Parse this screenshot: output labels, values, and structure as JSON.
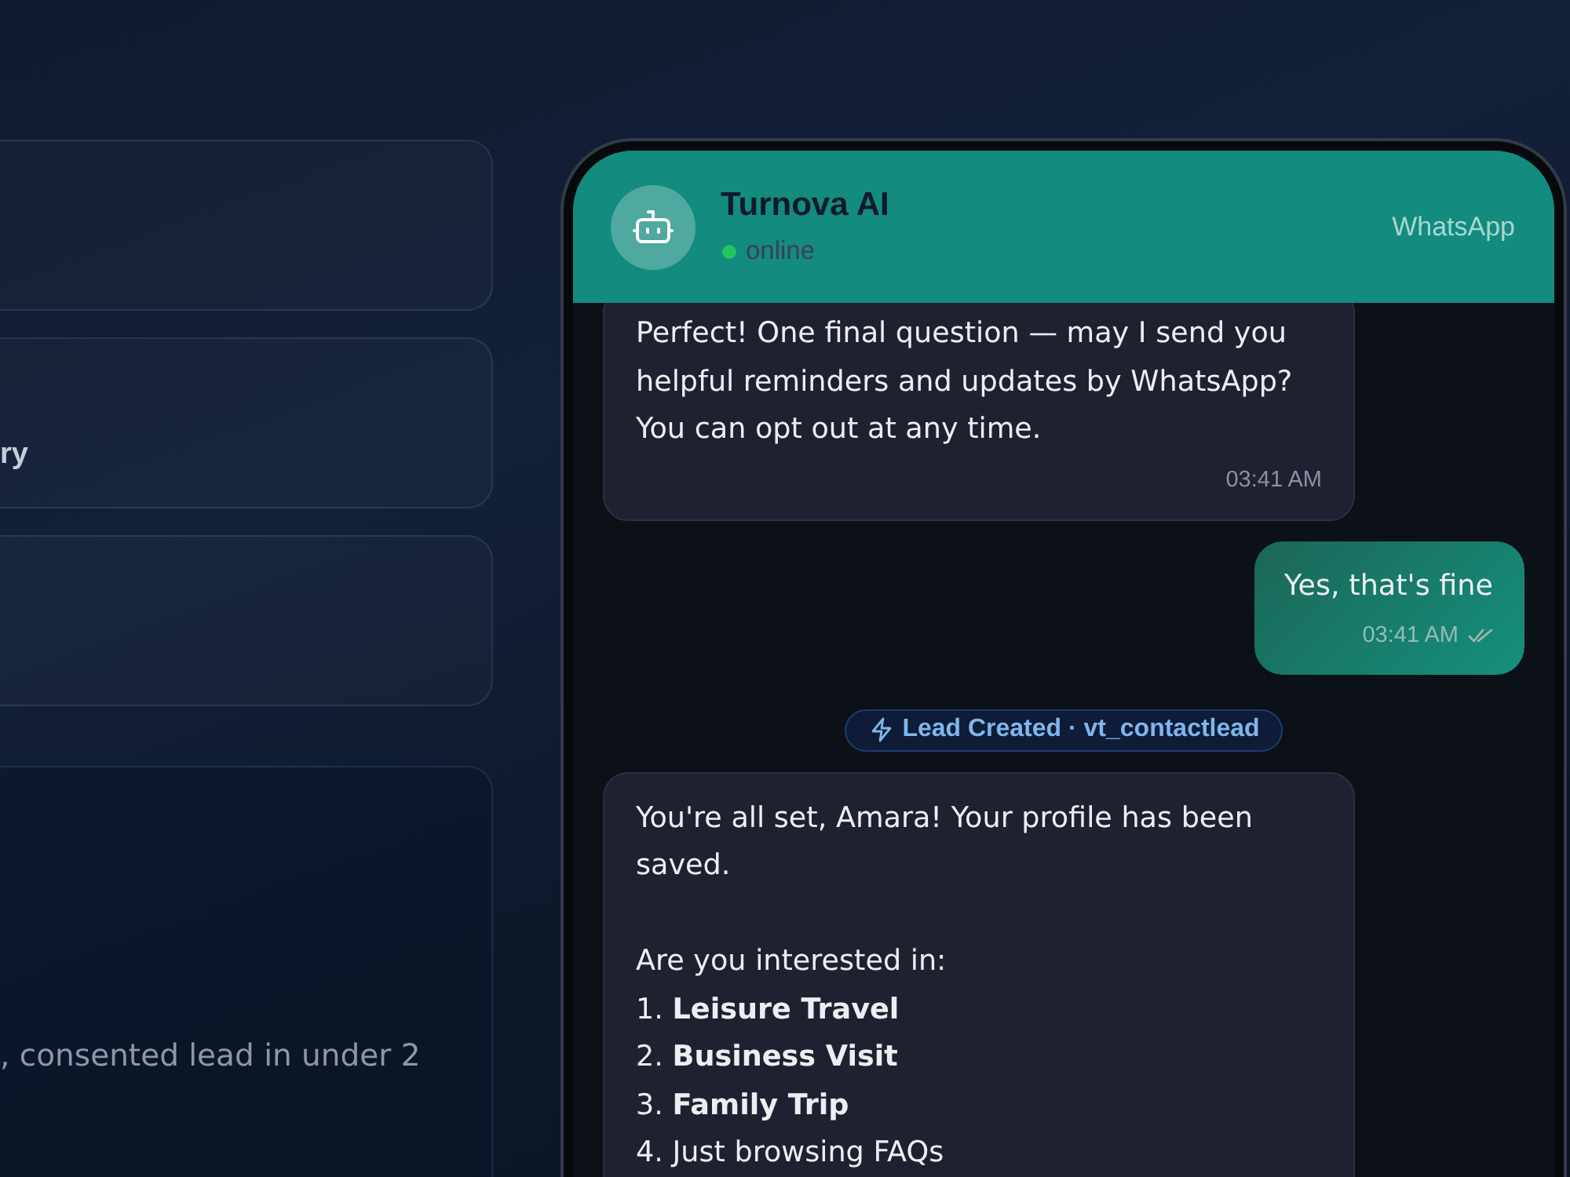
{
  "side_cards": [
    {
      "kind": "blank"
    },
    {
      "kind": "heading",
      "text": "ry"
    },
    {
      "kind": "blank"
    },
    {
      "kind": "description",
      "text": ", consented lead in under 2"
    }
  ],
  "chat": {
    "header": {
      "name": "Turnova AI",
      "online": true,
      "status": "online",
      "channel": "WhatsApp"
    },
    "messages": [
      {
        "kind": "incoming",
        "text": "Perfect! One final question — may I send you helpful reminders and updates by WhatsApp? You can opt out at any time.",
        "time": "03:41 AM"
      },
      {
        "kind": "outgoing",
        "text": "Yes, that's fine",
        "time": "03:41 AM",
        "delivered": true
      },
      {
        "kind": "event",
        "text": "Lead Created · vt_contactlead"
      },
      {
        "kind": "incoming",
        "text": "You're all set, Amara! Your profile has been saved.\n\nAre you interested in:\n1. **Leisure Travel**\n2. **Business Visit**\n3. **Family Trip**\n4. Just browsing FAQs"
      }
    ]
  }
}
